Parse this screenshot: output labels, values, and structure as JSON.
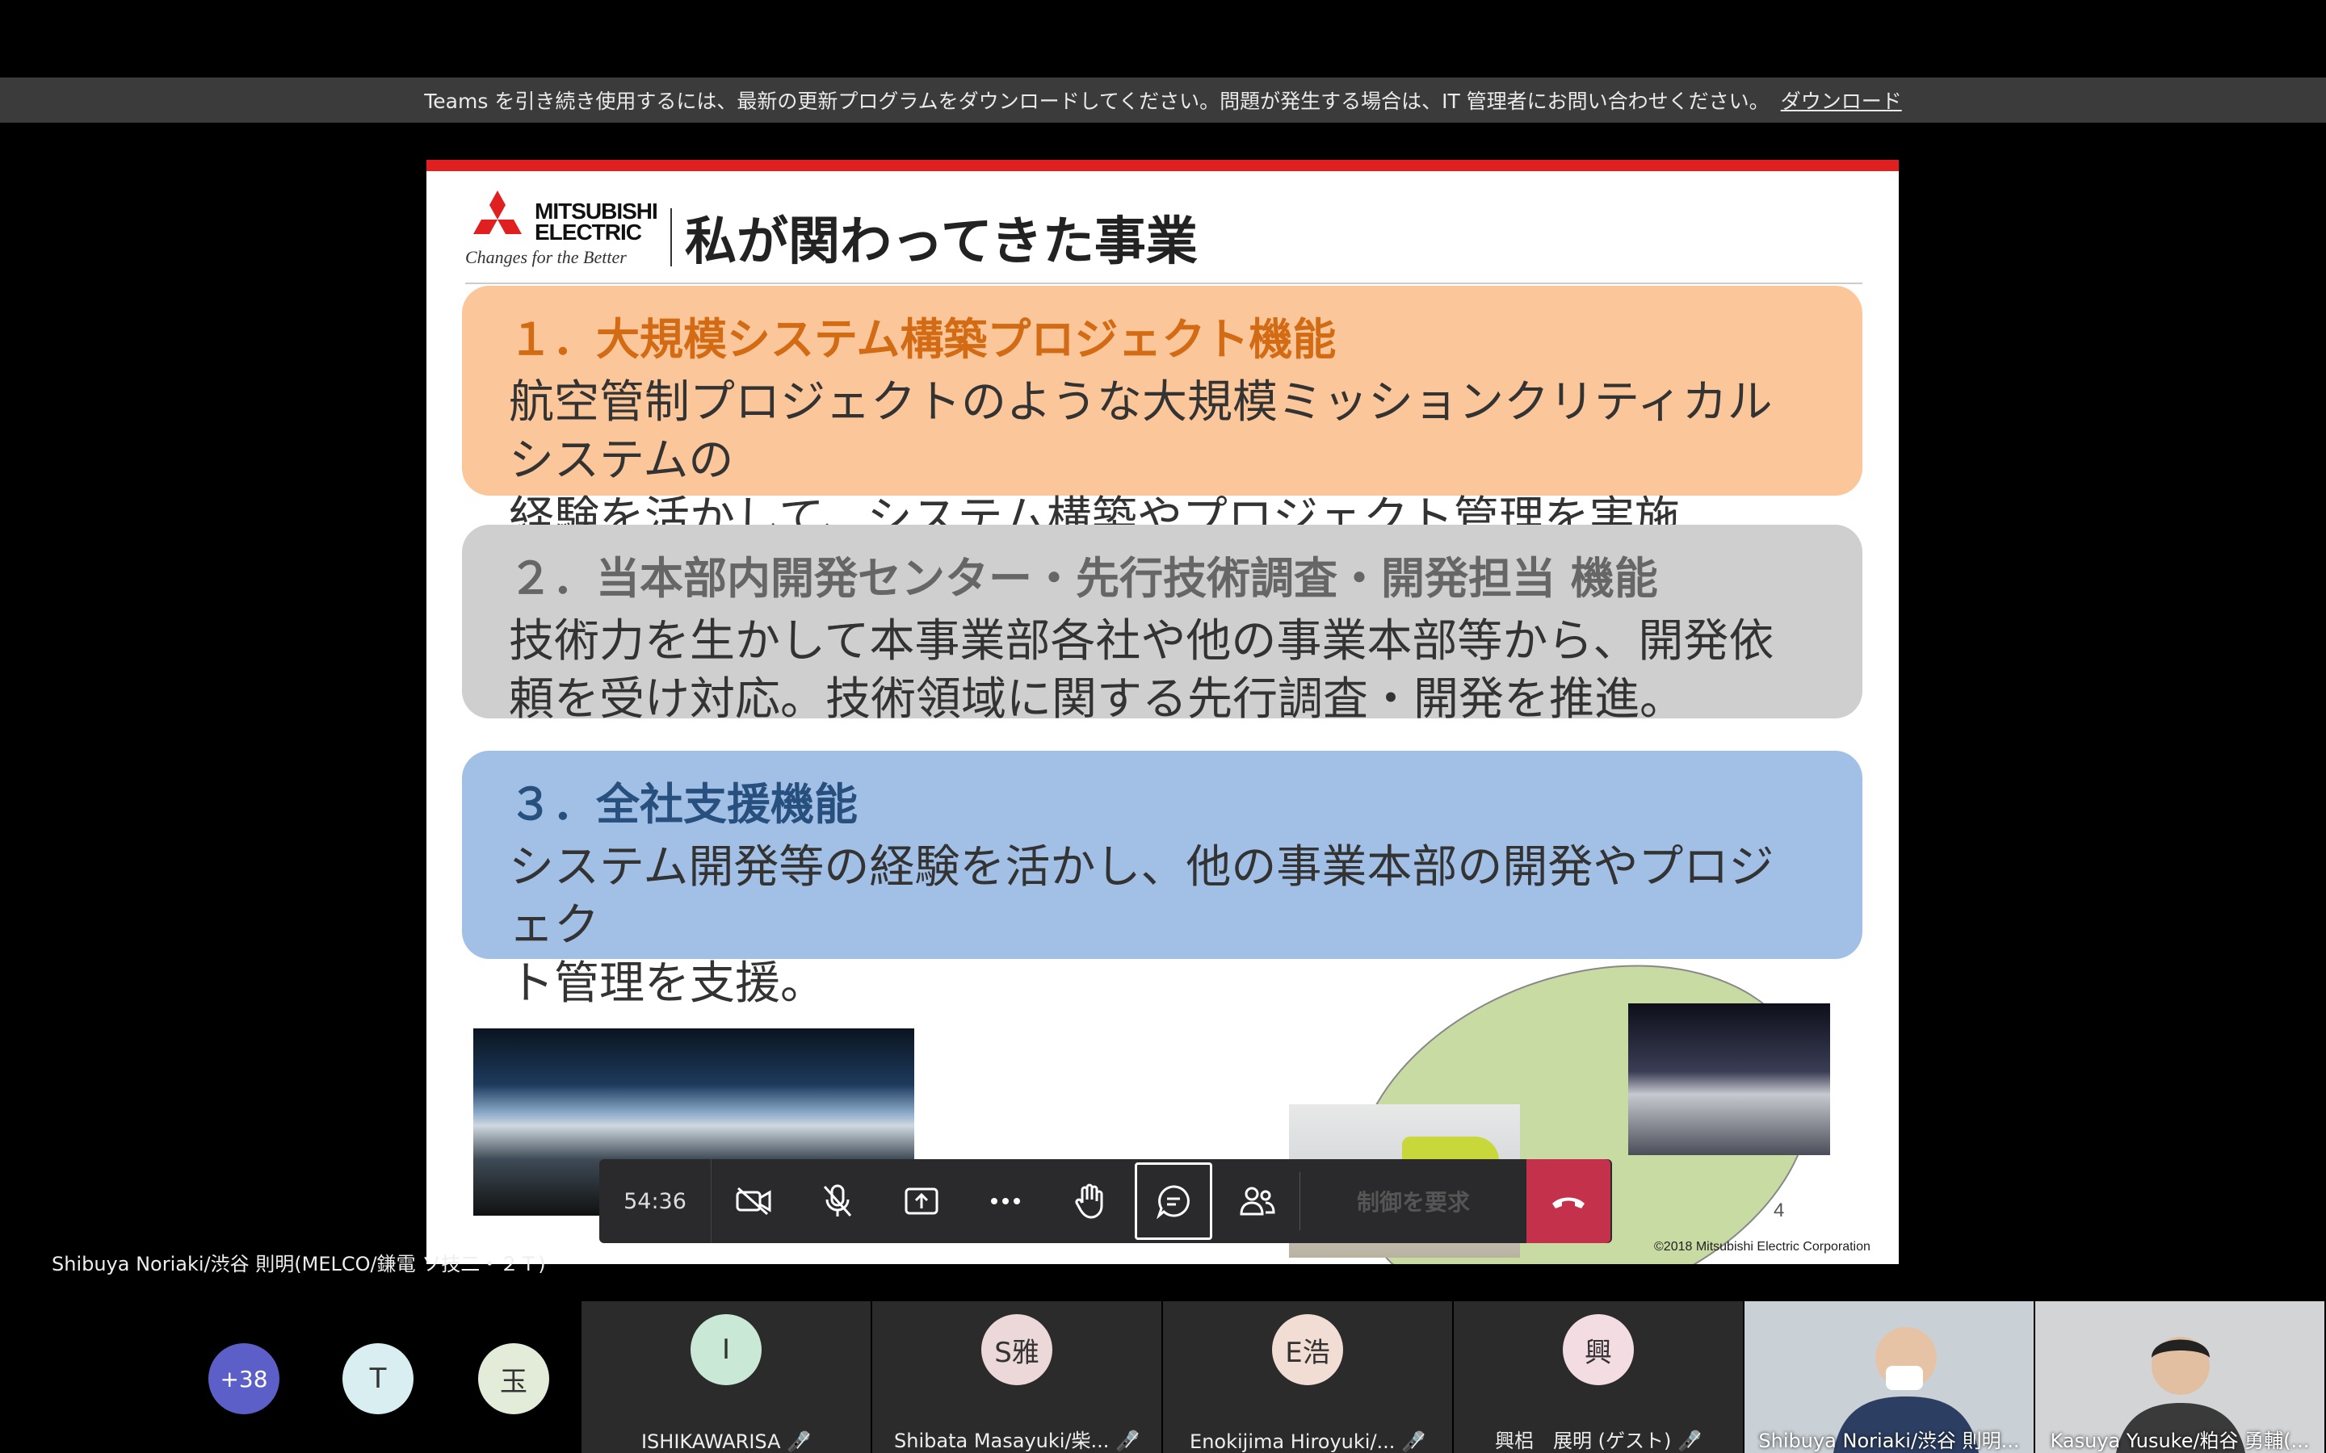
{
  "banner": {
    "message": "Teams を引き続き使用するには、最新の更新プログラムをダウンロードしてください。問題が発生する場合は、IT 管理者にお問い合わせください。",
    "link": "ダウンロード"
  },
  "slide": {
    "logo_line1": "MITSUBISHI",
    "logo_line2": "ELECTRIC",
    "logo_tagline": "Changes for the Better",
    "title": "私が関わってきた事業",
    "sections": [
      {
        "heading": "１．大規模システム構築プロジェクト機能",
        "body1": "航空管制プロジェクトのような大規模ミッションクリティカルシステムの",
        "body2": "経験を活かして、システム構築やプロジェクト管理を実施"
      },
      {
        "heading": "２．当本部内開発センター・先行技術調査・開発担当 機能",
        "body1": "技術力を生かして本事業部各社や他の事業本部等から、開発依",
        "body2": "頼を受け対応。技術領域に関する先行調査・開発を推進。"
      },
      {
        "heading": "３．全社支援機能",
        "body1": "システム開発等の経験を活かし、他の事業本部の開発やプロジェク",
        "body2": "ト管理を支援。"
      }
    ],
    "page_number": "4",
    "copyright": "©2018 Mitsubishi Electric Corporation"
  },
  "toolbar": {
    "timer": "54:36",
    "request_control": "制御を要求",
    "icons": [
      "camera-off-icon",
      "mic-off-icon",
      "share-icon",
      "more-icon",
      "raise-hand-icon",
      "chat-icon",
      "participants-icon",
      "hang-up-icon"
    ]
  },
  "presenter_name": "Shibuya Noriaki/渋谷 則明(MELCO/鎌電 ソ技二・２Ｔ)",
  "gallery": {
    "overflow_count": "+38",
    "small_avatars": [
      {
        "initial": "T",
        "color": "#d8eef0"
      },
      {
        "initial": "玉",
        "color": "#e3ecd8"
      }
    ],
    "tiles": [
      {
        "initial": "I",
        "name": "ISHIKAWARISA",
        "color": "#c9e8d6"
      },
      {
        "initial": "S雅",
        "name": "Shibata Masayuki/柴...",
        "color": "#ecd8d8"
      },
      {
        "initial": "E浩",
        "name": "Enokijima Hiroyuki/...",
        "color": "#f1ddd3"
      },
      {
        "initial": "興",
        "name": "興梠　展明 (ゲスト)",
        "color": "#f3dde3"
      }
    ],
    "videos": [
      {
        "name": "Shibuya Noriaki/渋谷 則明..."
      },
      {
        "name": "Kasuya Yusuke/粕谷 勇輔(..."
      }
    ]
  },
  "colors": {
    "accent_red": "#e02020",
    "hangup": "#c4314b",
    "box1": "#fbc79a",
    "box2": "#cfcfcf",
    "box3": "#a2c0e6"
  }
}
